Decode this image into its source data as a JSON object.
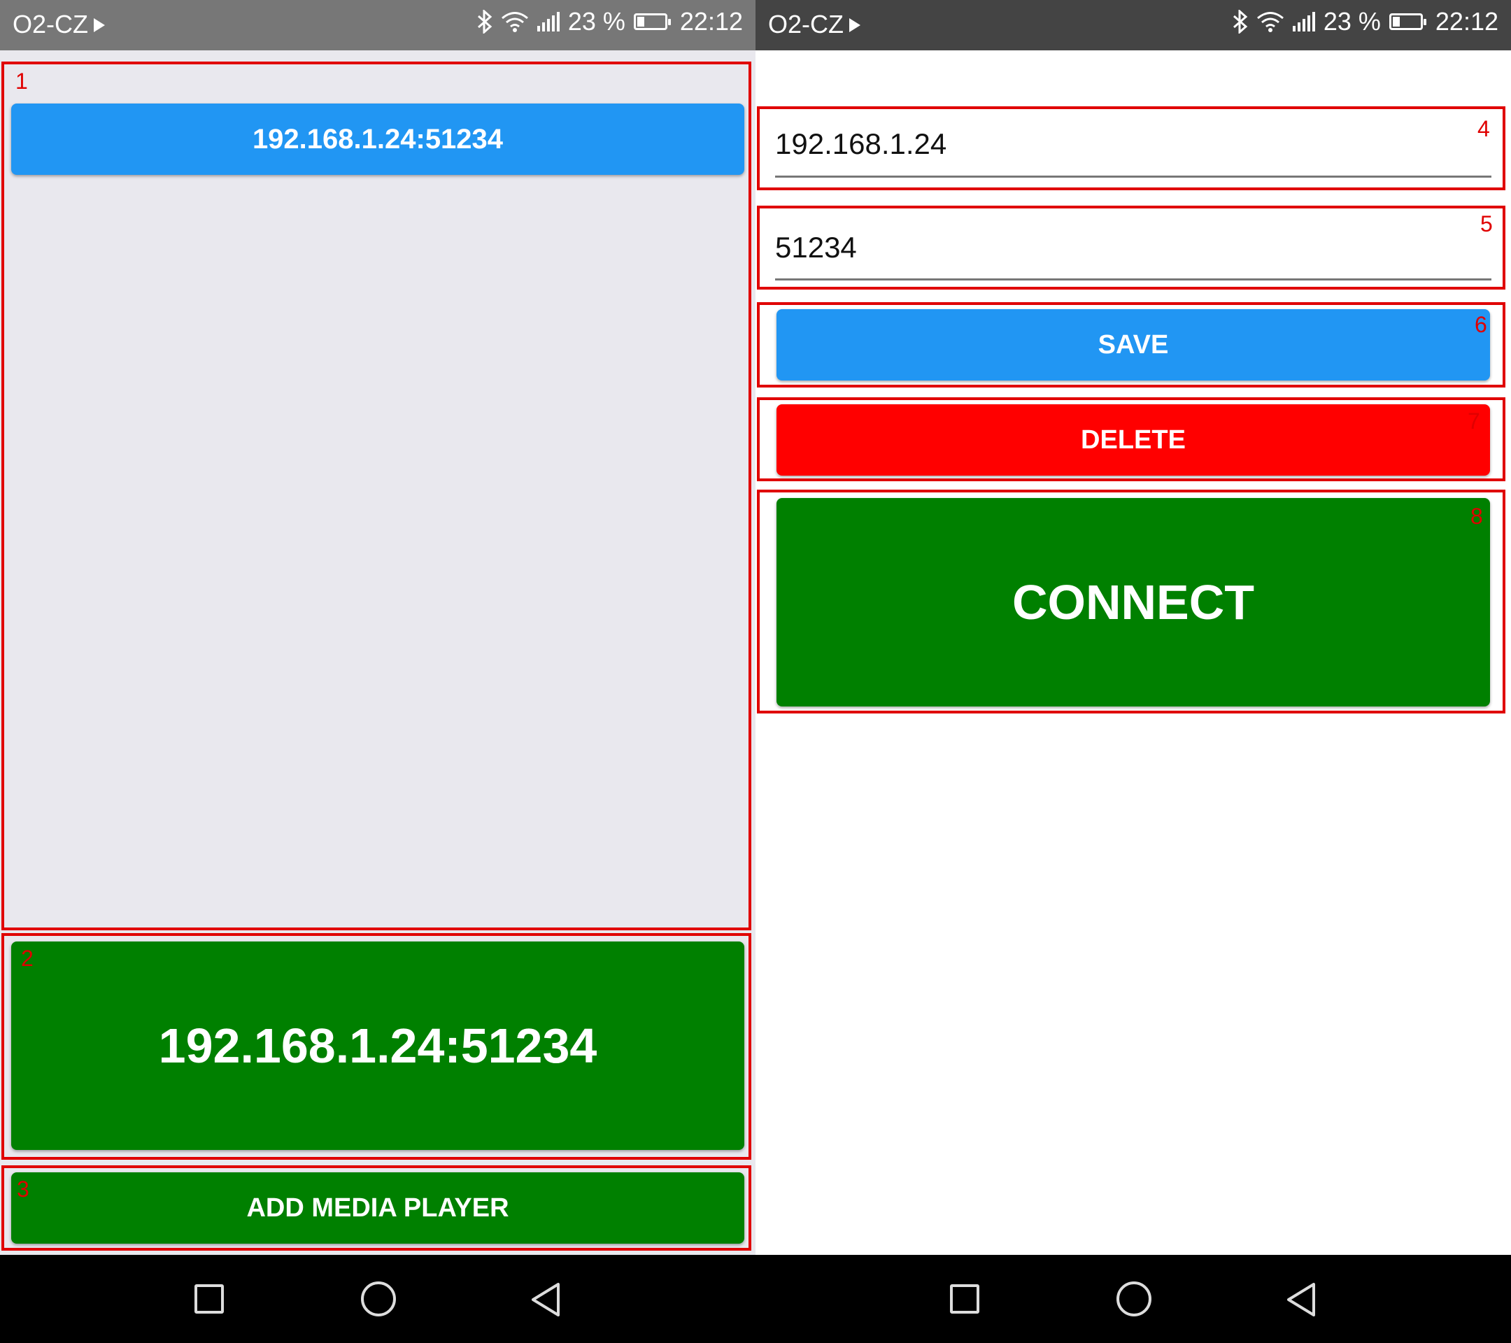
{
  "status_bar": {
    "carrier": "O2-CZ",
    "battery": "23 %",
    "battery_level": 0.23,
    "time": "22:12"
  },
  "left_screen": {
    "list_items": [
      {
        "label": "192.168.1.24:51234"
      }
    ],
    "selected_player": "192.168.1.24:51234",
    "add_button": "ADD MEDIA PLAYER"
  },
  "right_screen": {
    "ip_field": {
      "value": "192.168.1.24"
    },
    "port_field": {
      "value": "51234"
    },
    "save_button": "SAVE",
    "delete_button": "DELETE",
    "connect_button": "CONNECT"
  },
  "annotations": [
    "1",
    "2",
    "3",
    "4",
    "5",
    "6",
    "7",
    "8"
  ],
  "colors": {
    "blue": "#2196f3",
    "green": "#008000",
    "red": "#ff0000",
    "annotation": "#e00000"
  },
  "icons": {
    "status": [
      "play-icon",
      "bluetooth-icon",
      "wifi-icon",
      "signal-icon",
      "battery-icon"
    ],
    "nav": [
      "recents-square-icon",
      "home-circle-icon",
      "back-triangle-icon"
    ]
  }
}
